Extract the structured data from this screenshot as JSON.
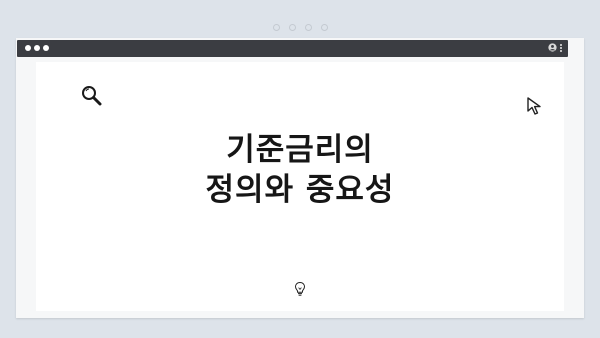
{
  "page": {
    "heading_line1": "기준금리의",
    "heading_line2": "정의와 중요성"
  },
  "icons": {
    "top_indicator": "dots-indicator",
    "window_controls": "three-dots-icon",
    "profile": "user-icon",
    "menu": "kebab-menu-icon",
    "search": "search-icon",
    "cursor": "cursor-icon",
    "idea": "lightbulb-icon"
  },
  "colors": {
    "background": "#dde3ea",
    "titlebar": "#3b3d42",
    "content": "#ffffff",
    "text": "#161616"
  }
}
